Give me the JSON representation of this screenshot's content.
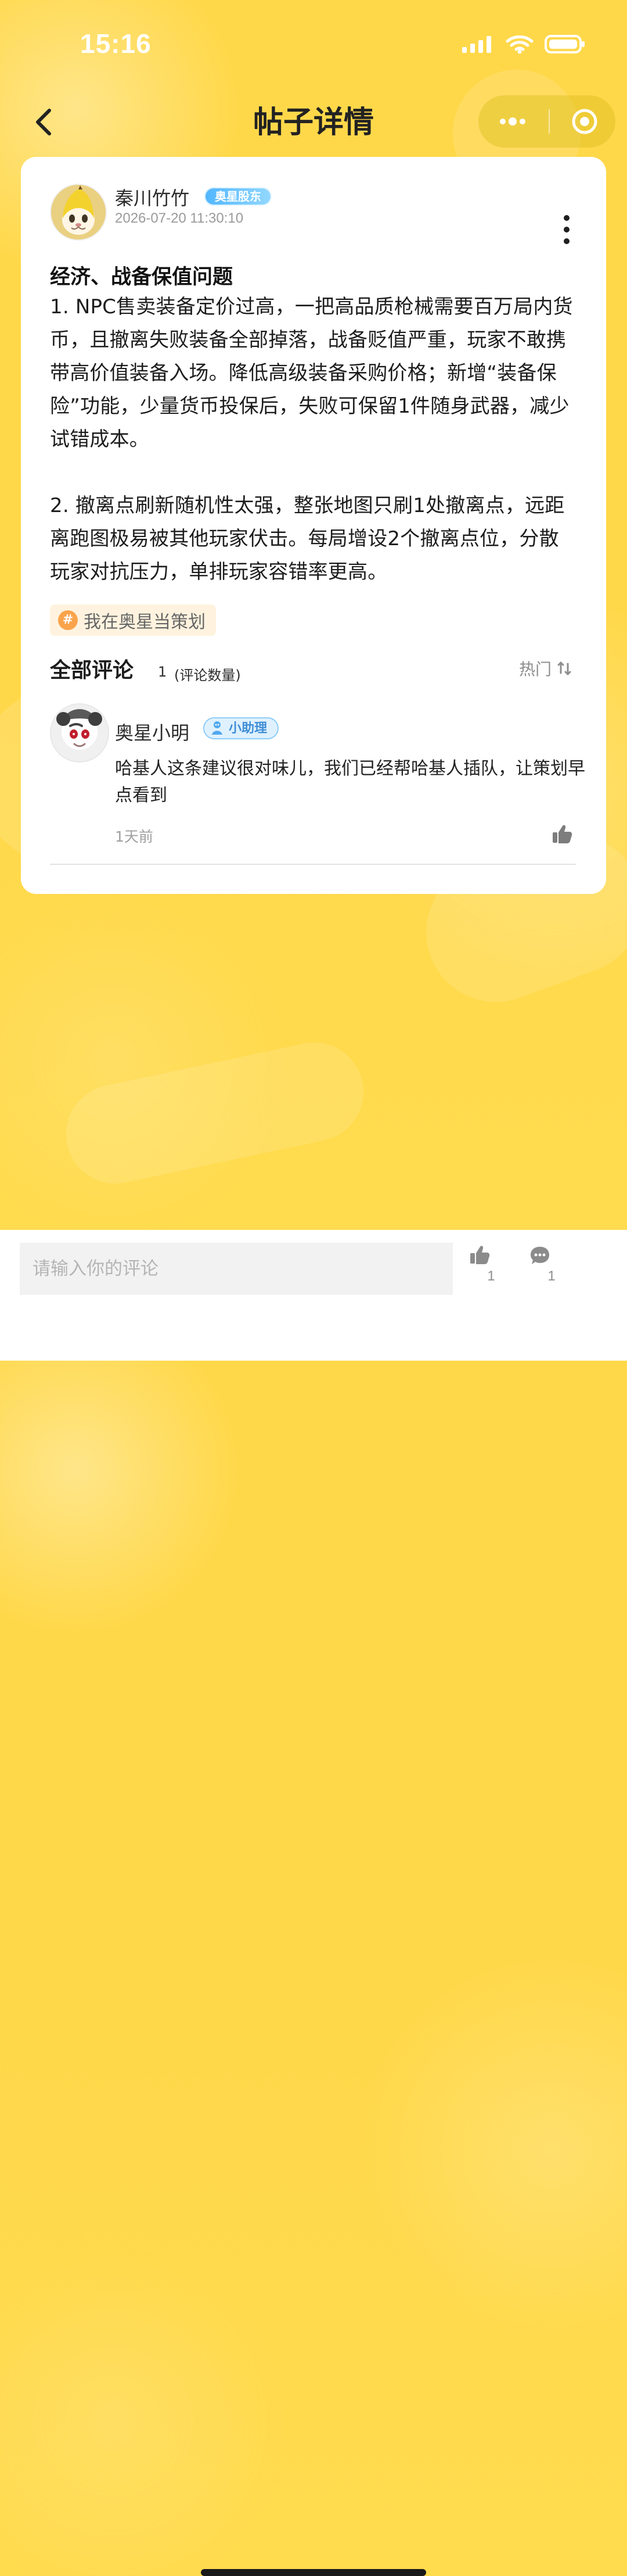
{
  "status_bar": {
    "time": "15:16",
    "icons": [
      "signal-icon",
      "wifi-icon",
      "battery-icon"
    ]
  },
  "header": {
    "title": "帖子详情",
    "icons": [
      "back-icon",
      "more-dots-icon",
      "target-icon"
    ]
  },
  "post": {
    "author": {
      "name": "秦川竹竹",
      "badge": "奥星股东",
      "time": "2026-07-20 11:30:10"
    },
    "title": "经济、战备保值问题",
    "paragraphs": [
      "1. NPC售卖装备定价过高，一把高品质枪械需要百万局内货币，且撤离失败装备全部掉落，战备贬值严重，玩家不敢携带高价值装备入场。降低高级装备采购价格；新增“装备保险”功能，少量货币投保后，失败可保留1件随身武器，减少试错成本。",
      "2. 撤离点刷新随机性太强，整张地图只刷1处撤离点，远距离跑图极易被其他玩家伏击。每局增设2个撤离点位，分散玩家对抗压力，单排玩家容错率更高。"
    ],
    "topic": {
      "symbol": "#",
      "label": "我在奥星当策划"
    }
  },
  "comments": {
    "title": "全部评论",
    "count": "1",
    "count_label": "(评论数量)",
    "sort_label": "热门",
    "items": [
      {
        "user": "奥星小明",
        "badge": "小助理",
        "text": "哈基人这条建议很对味儿，我们已经帮哈基人插队，让策划早点看到",
        "time": "1天前"
      }
    ]
  },
  "bottom_bar": {
    "input_placeholder": "请输入你的评论",
    "like_count": "1",
    "comment_count": "1"
  },
  "colors": {
    "background": "#ffd84a",
    "card": "#ffffff",
    "badge_blue": "#51b6ff",
    "topic_orange": "#f9a44c"
  }
}
